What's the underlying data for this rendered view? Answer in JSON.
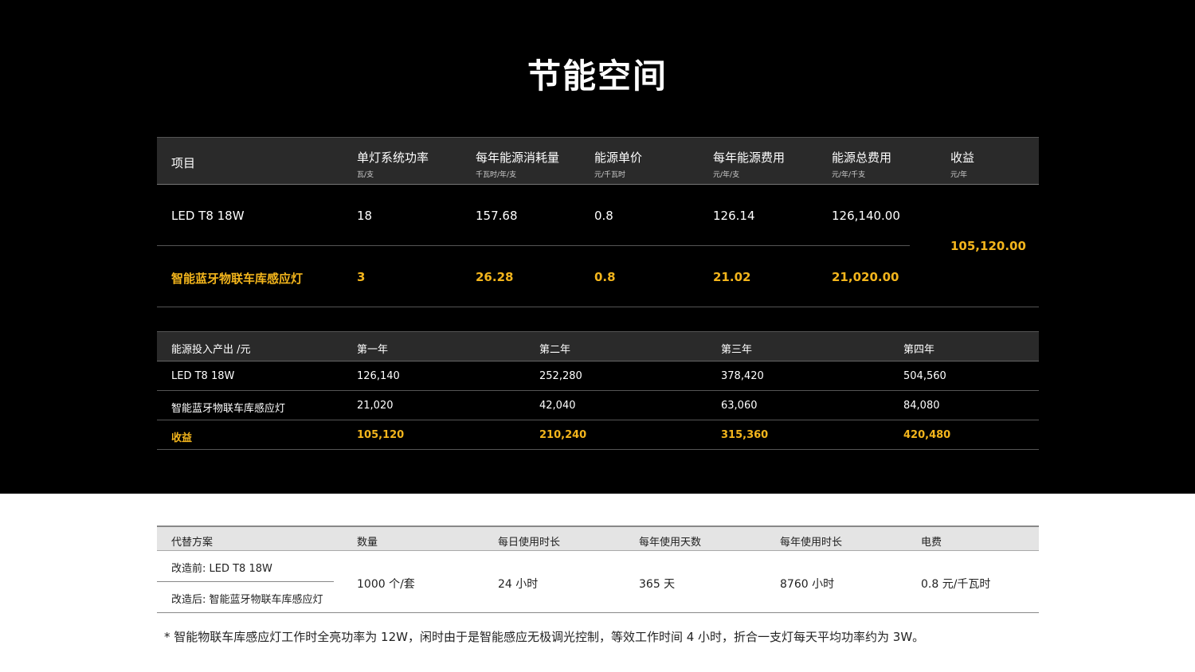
{
  "title": "节能空间",
  "table1": {
    "headers": [
      {
        "label": "项目",
        "unit": ""
      },
      {
        "label": "单灯系统功率",
        "unit": "瓦/支"
      },
      {
        "label": "每年能源消耗量",
        "unit": "千瓦时/年/支"
      },
      {
        "label": "能源单价",
        "unit": "元/千瓦时"
      },
      {
        "label": "每年能源费用",
        "unit": "元/年/支"
      },
      {
        "label": "能源总费用",
        "unit": "元/年/千支"
      },
      {
        "label": "收益",
        "unit": "元/年"
      }
    ],
    "rows": [
      {
        "item": "LED T8 18W",
        "power": "18",
        "consumption": "157.68",
        "price": "0.8",
        "annual_cost": "126.14",
        "total_cost": "126,140.00"
      },
      {
        "item": "智能蓝牙物联车库感应灯",
        "power": "3",
        "consumption": "26.28",
        "price": "0.8",
        "annual_cost": "21.02",
        "total_cost": "21,020.00"
      }
    ],
    "benefit": "105,120.00"
  },
  "table2": {
    "headers": [
      "能源投入产出 /元",
      "第一年",
      "第二年",
      "第三年",
      "第四年"
    ],
    "rows": [
      [
        "LED T8 18W",
        "126,140",
        "252,280",
        "378,420",
        "504,560"
      ],
      [
        "智能蓝牙物联车库感应灯",
        "21,020",
        "42,040",
        "63,060",
        "84,080"
      ],
      [
        "收益",
        "105,120",
        "210,240",
        "315,360",
        "420,480"
      ]
    ]
  },
  "table3": {
    "headers": [
      "代替方案",
      "数量",
      "每日使用时长",
      "每年使用天数",
      "每年使用时长",
      "电费"
    ],
    "before": "改造前: LED T8 18W",
    "after": "改造后: 智能蓝牙物联车库感应灯",
    "quantity": "1000 个/套",
    "daily_hours": "24 小时",
    "annual_days": "365 天",
    "annual_hours": "8760 小时",
    "electricity": "0.8 元/千瓦时"
  },
  "footnote": "* 智能物联车库感应灯工作时全亮功率为 12W，闲时由于是智能感应无极调光控制，等效工作时间 4 小时，折合一支灯每天平均功率约为 3W。",
  "colors": {
    "highlight": "#f3b51c",
    "dark_bg": "#000000",
    "header_bg": "#2a2a2a"
  }
}
